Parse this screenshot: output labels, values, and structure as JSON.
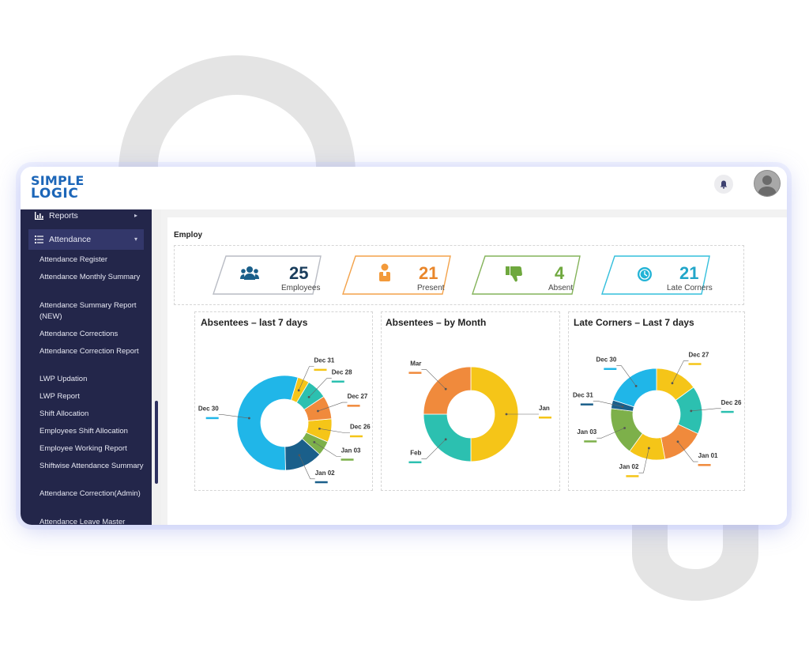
{
  "brand": {
    "line1": "SIMPLE",
    "line2": "LOGIC",
    "color": "#1c66b8"
  },
  "header": {
    "bell_icon": "bell-icon",
    "avatar_icon": "user-avatar-icon"
  },
  "sidebar": {
    "background": "#23264a",
    "sections": [
      {
        "label": "Reports",
        "icon": "bar-chart-icon",
        "expanded": false
      },
      {
        "label": "Attendance",
        "icon": "list-icon",
        "expanded": true
      }
    ],
    "items": [
      "Attendance Register",
      "Attendance Monthly Summary",
      "Attendance Summary Report (NEW)",
      "Attendance Corrections",
      "Attendance Correction Report",
      "LWP Updation",
      "LWP Report",
      "Shift Allocation",
      "Employees Shift Allocation",
      "Employee Working Report",
      "Shiftwise Attendance Summary",
      "Attendance Correction(Admin)",
      "Attendance Leave Master"
    ]
  },
  "page": {
    "title": "Employ"
  },
  "stats": [
    {
      "value": "25",
      "label": "Employees",
      "icon": "users-icon",
      "color": "#1a5f8a"
    },
    {
      "value": "21",
      "label": "Present",
      "icon": "person-present-icon",
      "color": "#f39a3a"
    },
    {
      "value": "4",
      "label": "Absent",
      "icon": "thumbs-down-icon",
      "color": "#7db04a"
    },
    {
      "value": "21",
      "label": "Late Corners",
      "icon": "clock-icon",
      "color": "#2bb8d6"
    }
  ],
  "chart_data": [
    {
      "type": "pie",
      "title": "Absentees – last 7 days",
      "categories": [
        "Dec 26",
        "Jan 03",
        "Jan 02",
        "Dec 30",
        "Dec 31",
        "Dec 28",
        "Dec 27"
      ],
      "values": [
        8,
        5,
        13,
        55,
        4,
        7,
        8
      ],
      "colors": [
        "#f5c518",
        "#7db04a",
        "#1a5f8a",
        "#20b6e8",
        "#f5c518",
        "#2cc0b0",
        "#f08a3c"
      ]
    },
    {
      "type": "pie",
      "title": "Absentees – by Month",
      "categories": [
        "Jan",
        "Feb",
        "Mar"
      ],
      "values": [
        50,
        25,
        25
      ],
      "colors": [
        "#f5c518",
        "#2cc0b0",
        "#f08a3c"
      ]
    },
    {
      "type": "pie",
      "title": "Late Corners – Last 7 days",
      "categories": [
        "Dec 27",
        "Dec 26",
        "Jan 01",
        "Jan 02",
        "Jan 03",
        "Dec 31",
        "Dec 30"
      ],
      "values": [
        15,
        17,
        15,
        13,
        17,
        3,
        20
      ],
      "colors": [
        "#f5c518",
        "#2cc0b0",
        "#f08a3c",
        "#f5c518",
        "#7db04a",
        "#1a5f8a",
        "#20b6e8"
      ]
    }
  ]
}
